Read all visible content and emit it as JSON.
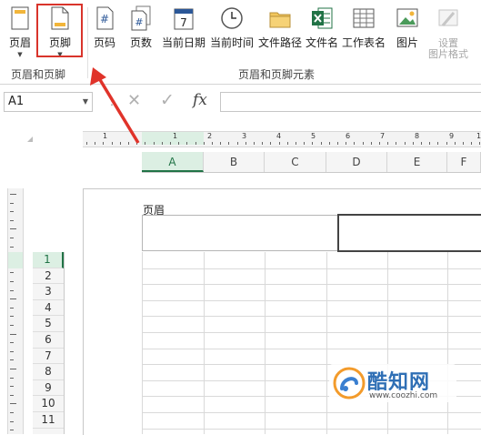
{
  "ribbon": {
    "buttons": [
      {
        "id": "header",
        "label": "页眉",
        "dropdown": true
      },
      {
        "id": "footer",
        "label": "页脚",
        "dropdown": true
      },
      {
        "id": "page-number",
        "label": "页码"
      },
      {
        "id": "page-count",
        "label": "页数"
      },
      {
        "id": "current-date",
        "label": "当前日期"
      },
      {
        "id": "current-time",
        "label": "当前时间"
      },
      {
        "id": "file-path",
        "label": "文件路径"
      },
      {
        "id": "file-name",
        "label": "文件名"
      },
      {
        "id": "sheet-name",
        "label": "工作表名"
      },
      {
        "id": "picture",
        "label": "图片"
      },
      {
        "id": "format-picture",
        "label_line1": "设置",
        "label_line2": "图片格式",
        "disabled": true
      }
    ],
    "groups": {
      "header_footer": "页眉和页脚",
      "elements": "页眉和页脚元素"
    },
    "icon_glyphs": {
      "date_day": "7",
      "page_number": "#"
    },
    "accent": "#d9342b"
  },
  "formula_bar": {
    "name_box": "A1",
    "cancel_glyph": "✕",
    "enter_glyph": "✓",
    "fx_label": "fx",
    "formula_value": ""
  },
  "ruler": {
    "numbers": [
      "1",
      "1",
      "2",
      "3",
      "4",
      "5",
      "6",
      "7",
      "8",
      "9",
      "1"
    ]
  },
  "columns": [
    "A",
    "B",
    "C",
    "D",
    "E",
    "F"
  ],
  "active_column": "A",
  "page": {
    "header_label": "页眉"
  },
  "rows": [
    "1",
    "2",
    "3",
    "4",
    "5",
    "6",
    "7",
    "8",
    "9",
    "10",
    "11"
  ],
  "active_row": "1",
  "watermark": {
    "title": "酷知网",
    "url": "www.coozhi.com"
  },
  "colors": {
    "excel_green": "#217346",
    "active_header_bg": "#dcefe3",
    "highlight_red": "#d9342b"
  }
}
